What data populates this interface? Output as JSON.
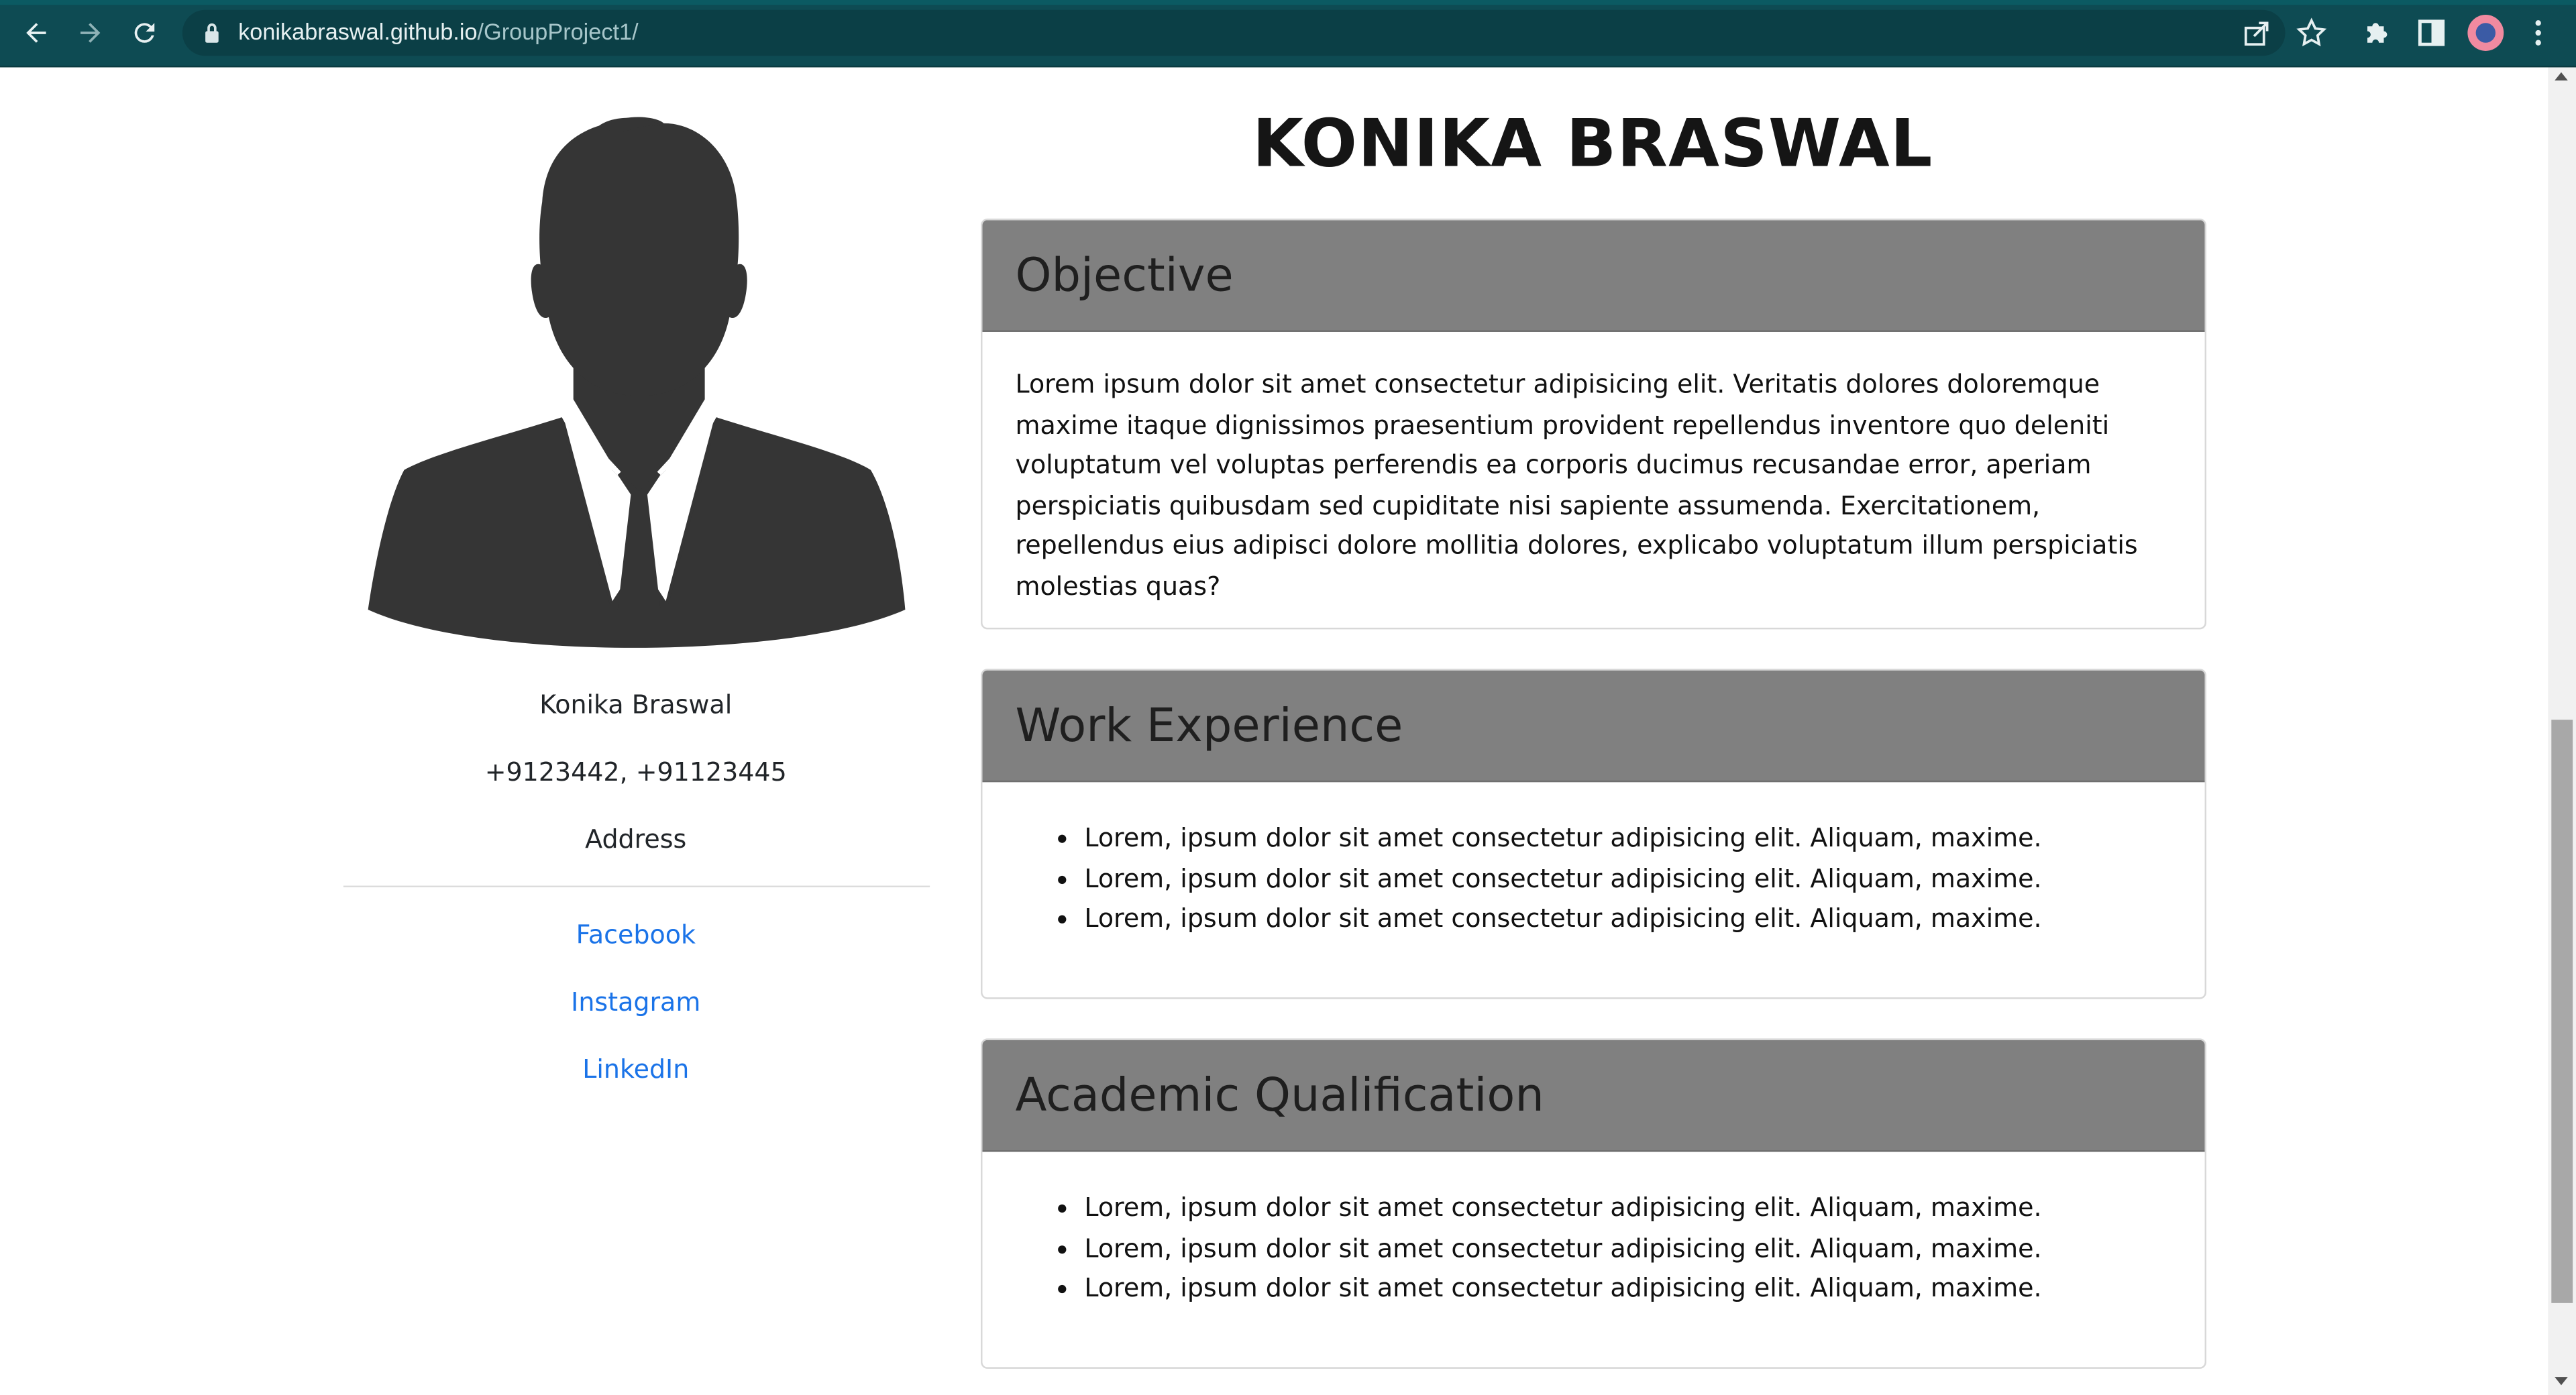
{
  "browser": {
    "url_host": "konikabraswal.github.io",
    "url_path": "/GroupProject1/"
  },
  "profile": {
    "name": "Konika Braswal",
    "phone": "+9123442, +91123445",
    "address": "Address",
    "links": [
      "Facebook",
      "Instagram",
      "LinkedIn"
    ]
  },
  "main": {
    "title": "KONIKA BRASWAL",
    "objective": {
      "heading": "Objective",
      "text": "Lorem ipsum dolor sit amet consectetur adipisicing elit. Veritatis dolores doloremque maxime itaque dignissimos praesentium provident repellendus inventore quo deleniti voluptatum vel voluptas perferendis ea corporis ducimus recusandae error, aperiam perspiciatis quibusdam sed cupiditate nisi sapiente assumenda. Exercitationem, repellendus eius adipisci dolore mollitia dolores, explicabo voluptatum illum perspiciatis molestias quas?"
    },
    "work_experience": {
      "heading": "Work Experience",
      "items": [
        "Lorem, ipsum dolor sit amet consectetur adipisicing elit. Aliquam, maxime.",
        "Lorem, ipsum dolor sit amet consectetur adipisicing elit. Aliquam, maxime.",
        "Lorem, ipsum dolor sit amet consectetur adipisicing elit. Aliquam, maxime."
      ]
    },
    "academic": {
      "heading": "Academic Qualification",
      "items": [
        "Lorem, ipsum dolor sit amet consectetur adipisicing elit. Aliquam, maxime.",
        "Lorem, ipsum dolor sit amet consectetur adipisicing elit. Aliquam, maxime.",
        "Lorem, ipsum dolor sit amet consectetur adipisicing elit. Aliquam, maxime."
      ]
    }
  },
  "icons": {
    "back": "back-arrow-icon",
    "forward": "forward-arrow-icon",
    "reload": "reload-icon",
    "lock": "lock-icon",
    "share": "share-icon",
    "bookmark": "star-icon",
    "extensions": "puzzle-icon",
    "side_panel": "side-panel-icon",
    "profile": "profile-avatar-icon",
    "menu": "kebab-menu-icon"
  },
  "colors": {
    "chrome_bg": "#0e4b53",
    "card_header": "#808080",
    "link": "#1a73e8",
    "silhouette": "#353535"
  }
}
